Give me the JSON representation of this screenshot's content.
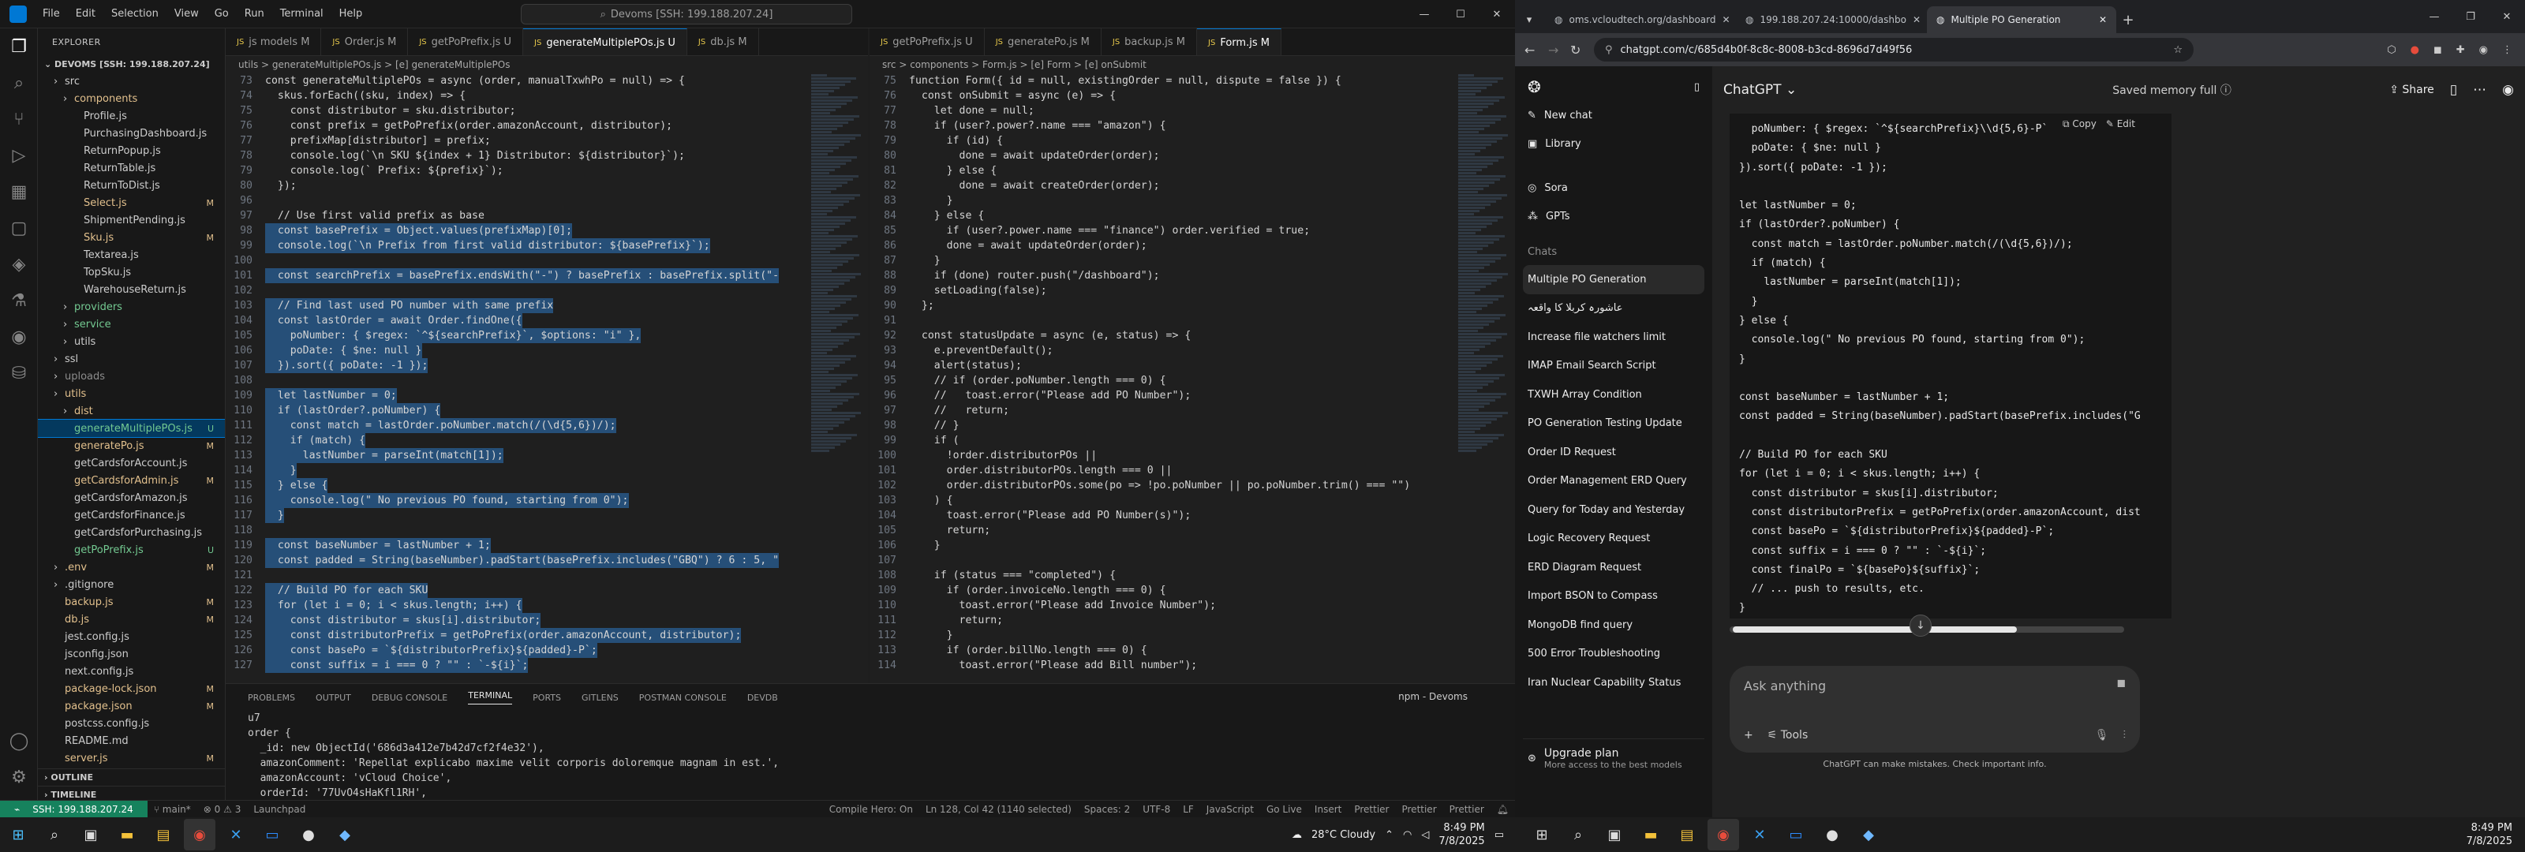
{
  "vscode": {
    "menu": [
      "File",
      "Edit",
      "Selection",
      "View",
      "Go",
      "Run",
      "Terminal",
      "Help"
    ],
    "command_center": "Devoms [SSH: 199.188.207.24]",
    "explorer_title": "EXPLORER",
    "workspace": "DEVOMS [SSH: 199.188.207.24]",
    "tree": [
      {
        "label": "src",
        "cls": "c-nor",
        "indent": 1
      },
      {
        "label": "components",
        "cls": "c-mod",
        "indent": 2
      },
      {
        "label": "Profile.js",
        "cls": "c-nor",
        "indent": 3
      },
      {
        "label": "PurchasingDashboard.js",
        "cls": "c-nor",
        "indent": 3
      },
      {
        "label": "ReturnPopup.js",
        "cls": "c-nor",
        "indent": 3
      },
      {
        "label": "ReturnTable.js",
        "cls": "c-nor",
        "indent": 3
      },
      {
        "label": "ReturnToDist.js",
        "cls": "c-nor",
        "indent": 3
      },
      {
        "label": "Select.js",
        "cls": "c-mod",
        "indent": 3,
        "badge": "M"
      },
      {
        "label": "ShipmentPending.js",
        "cls": "c-nor",
        "indent": 3
      },
      {
        "label": "Sku.js",
        "cls": "c-mod",
        "indent": 3,
        "badge": "M"
      },
      {
        "label": "Textarea.js",
        "cls": "c-nor",
        "indent": 3
      },
      {
        "label": "TopSku.js",
        "cls": "c-nor",
        "indent": 3
      },
      {
        "label": "WarehouseReturn.js",
        "cls": "c-nor",
        "indent": 3
      },
      {
        "label": "providers",
        "cls": "c-unt",
        "indent": 2
      },
      {
        "label": "service",
        "cls": "c-unt",
        "indent": 2
      },
      {
        "label": "utils",
        "cls": "c-nor",
        "indent": 2
      },
      {
        "label": "ssl",
        "cls": "c-nor",
        "indent": 1
      },
      {
        "label": "uploads",
        "cls": "c-dim",
        "indent": 1
      },
      {
        "label": "utils",
        "cls": "c-mod",
        "indent": 1
      },
      {
        "label": "dist",
        "cls": "c-mod",
        "indent": 2
      },
      {
        "label": "generateMultiplePOs.js",
        "cls": "c-unt",
        "indent": 2,
        "badge": "U",
        "sel": true
      },
      {
        "label": "generatePo.js",
        "cls": "c-mod",
        "indent": 2,
        "badge": "M"
      },
      {
        "label": "getCardsforAccount.js",
        "cls": "c-nor",
        "indent": 2
      },
      {
        "label": "getCardsforAdmin.js",
        "cls": "c-mod",
        "indent": 2,
        "badge": "M"
      },
      {
        "label": "getCardsforAmazon.js",
        "cls": "c-nor",
        "indent": 2
      },
      {
        "label": "getCardsforFinance.js",
        "cls": "c-nor",
        "indent": 2
      },
      {
        "label": "getCardsforPurchasing.js",
        "cls": "c-nor",
        "indent": 2
      },
      {
        "label": "getPoPrefix.js",
        "cls": "c-unt",
        "indent": 2,
        "badge": "U"
      },
      {
        "label": ".env",
        "cls": "c-mod",
        "indent": 1,
        "badge": "M"
      },
      {
        "label": ".gitignore",
        "cls": "c-nor",
        "indent": 1
      },
      {
        "label": "backup.js",
        "cls": "c-mod",
        "indent": 1,
        "badge": "M"
      },
      {
        "label": "db.js",
        "cls": "c-mod",
        "indent": 1,
        "badge": "M"
      },
      {
        "label": "jest.config.js",
        "cls": "c-nor",
        "indent": 1
      },
      {
        "label": "jsconfig.json",
        "cls": "c-nor",
        "indent": 1
      },
      {
        "label": "next.config.js",
        "cls": "c-nor",
        "indent": 1
      },
      {
        "label": "package-lock.json",
        "cls": "c-mod",
        "indent": 1,
        "badge": "M"
      },
      {
        "label": "package.json",
        "cls": "c-mod",
        "indent": 1,
        "badge": "M"
      },
      {
        "label": "postcss.config.js",
        "cls": "c-nor",
        "indent": 1
      },
      {
        "label": "README.md",
        "cls": "c-nor",
        "indent": 1
      },
      {
        "label": "server.js",
        "cls": "c-mod",
        "indent": 1,
        "badge": "M"
      }
    ],
    "outline_label": "OUTLINE",
    "timeline_label": "TIMELINE",
    "left_tabs": [
      {
        "label": "js models M"
      },
      {
        "label": "Order.js M"
      },
      {
        "label": "getPoPrefix.js U"
      },
      {
        "label": "generateMultiplePOs.js U",
        "active": true
      },
      {
        "label": "db.js M"
      }
    ],
    "right_tabs": [
      {
        "label": "getPoPrefix.js U"
      },
      {
        "label": "generatePo.js M"
      },
      {
        "label": "backup.js M"
      },
      {
        "label": "Form.js M",
        "active": true
      }
    ],
    "left_breadcrumb": "utils > generateMultiplePOs.js > [e] generateMultiplePOs",
    "right_breadcrumb": "src > components > Form.js > [e] Form > [e] onSubmit",
    "left_code": [
      {
        "n": "73",
        "t": "const generateMultiplePOs = async (order, manualTxwhPo = null) => {"
      },
      {
        "n": "74",
        "t": "  skus.forEach((sku, index) => {"
      },
      {
        "n": "",
        "t": "    const distributor = sku.distributor;"
      },
      {
        "n": "",
        "t": "    const prefix = getPoPrefix(order.amazonAccount, distributor);"
      },
      {
        "n": "",
        "t": "    prefixMap[distributor] = prefix;"
      },
      {
        "n": "",
        "t": "    console.log(`\\n SKU ${index + 1} Distributor: ${distributor}`);"
      },
      {
        "n": "",
        "t": "    console.log(` Prefix: ${prefix}`);"
      },
      {
        "n": "",
        "t": "  });"
      },
      {
        "n": "96",
        "t": ""
      },
      {
        "n": "97",
        "t": "  // Use first valid prefix as base"
      },
      {
        "n": "98",
        "t": "  const basePrefix = Object.values(prefixMap)[0];",
        "hl": true
      },
      {
        "n": "99",
        "t": "  console.log(`\\n Prefix from first valid distributor: ${basePrefix}`);",
        "hl": true
      },
      {
        "n": "100",
        "t": "",
        "hl": true
      },
      {
        "n": "101",
        "t": "  const searchPrefix = basePrefix.endsWith(\"-\") ? basePrefix : basePrefix.split(\"-",
        "hl": true
      },
      {
        "n": "102",
        "t": "",
        "hl": true
      },
      {
        "n": "103",
        "t": "  // Find last used PO number with same prefix",
        "hl": true
      },
      {
        "n": "104",
        "t": "  const lastOrder = await Order.findOne({",
        "hl": true
      },
      {
        "n": "105",
        "t": "    poNumber: { $regex: `^${searchPrefix}`, $options: \"i\" },",
        "hl": true
      },
      {
        "n": "106",
        "t": "    poDate: { $ne: null }",
        "hl": true
      },
      {
        "n": "107",
        "t": "  }).sort({ poDate: -1 });",
        "hl": true
      },
      {
        "n": "108",
        "t": "",
        "hl": true
      },
      {
        "n": "109",
        "t": "  let lastNumber = 0;",
        "hl": true
      },
      {
        "n": "110",
        "t": "  if (lastOrder?.poNumber) {",
        "hl": true
      },
      {
        "n": "111",
        "t": "    const match = lastOrder.poNumber.match(/(\\d{5,6})/);",
        "hl": true
      },
      {
        "n": "112",
        "t": "    if (match) {",
        "hl": true
      },
      {
        "n": "113",
        "t": "      lastNumber = parseInt(match[1]);",
        "hl": true
      },
      {
        "n": "114",
        "t": "    }",
        "hl": true
      },
      {
        "n": "115",
        "t": "  } else {",
        "hl": true
      },
      {
        "n": "116",
        "t": "    console.log(\" No previous PO found, starting from 0\");",
        "hl": true
      },
      {
        "n": "117",
        "t": "  }",
        "hl": true
      },
      {
        "n": "118",
        "t": "",
        "hl": true
      },
      {
        "n": "119",
        "t": "  const baseNumber = lastNumber + 1;",
        "hl": true
      },
      {
        "n": "120",
        "t": "  const padded = String(baseNumber).padStart(basePrefix.includes(\"GBQ\") ? 6 : 5, \"",
        "hl": true
      },
      {
        "n": "121",
        "t": "",
        "hl": true
      },
      {
        "n": "122",
        "t": "  // Build PO for each SKU",
        "hl": true
      },
      {
        "n": "123",
        "t": "  for (let i = 0; i < skus.length; i++) {",
        "hl": true
      },
      {
        "n": "124",
        "t": "    const distributor = skus[i].distributor;",
        "hl": true
      },
      {
        "n": "125",
        "t": "    const distributorPrefix = getPoPrefix(order.amazonAccount, distributor);",
        "hl": true
      },
      {
        "n": "126",
        "t": "    const basePo = `${distributorPrefix}${padded}-P`;",
        "hl": true
      },
      {
        "n": "127",
        "t": "    const suffix = i === 0 ? \"\" : `-${i}`;",
        "hl": true
      }
    ],
    "right_code": [
      {
        "n": "75",
        "t": "function Form({ id = null, existingOrder = null, dispute = false }) {"
      },
      {
        "n": "76",
        "t": "  const onSubmit = async (e) => {"
      },
      {
        "n": "",
        "t": "    let done = null;"
      },
      {
        "n": "",
        "t": "    if (user?.power?.name === \"amazon\") {"
      },
      {
        "n": "",
        "t": "      if (id) {"
      },
      {
        "n": "",
        "t": "        done = await updateOrder(order);"
      },
      {
        "n": "",
        "t": "      } else {"
      },
      {
        "n": "",
        "t": "        done = await createOrder(order);"
      },
      {
        "n": "",
        "t": "      }"
      },
      {
        "n": "",
        "t": "    } else {"
      },
      {
        "n": "",
        "t": "      if (user?.power.name === \"finance\") order.verified = true;"
      },
      {
        "n": "",
        "t": "      done = await updateOrder(order);"
      },
      {
        "n": "",
        "t": "    }"
      },
      {
        "n": "",
        "t": "    if (done) router.push(\"/dashboard\");"
      },
      {
        "n": "",
        "t": "    setLoading(false);"
      },
      {
        "n": "",
        "t": "  };"
      },
      {
        "n": "",
        "t": ""
      },
      {
        "n": "",
        "t": "  const statusUpdate = async (e, status) => {"
      },
      {
        "n": "",
        "t": "    e.preventDefault();"
      },
      {
        "n": "",
        "t": "    alert(status);"
      },
      {
        "n": "",
        "t": "    // if (order.poNumber.length === 0) {"
      },
      {
        "n": "",
        "t": "    //   toast.error(\"Please add PO Number\");"
      },
      {
        "n": "",
        "t": "    //   return;"
      },
      {
        "n": "",
        "t": "    // }"
      },
      {
        "n": "",
        "t": "    if ("
      },
      {
        "n": "",
        "t": "      !order.distributorPOs ||"
      },
      {
        "n": "",
        "t": "      order.distributorPOs.length === 0 ||"
      },
      {
        "n": "",
        "t": "      order.distributorPOs.some(po => !po.poNumber || po.poNumber.trim() === \"\")"
      },
      {
        "n": "",
        "t": "    ) {"
      },
      {
        "n": "",
        "t": "      toast.error(\"Please add PO Number(s)\");"
      },
      {
        "n": "",
        "t": "      return;"
      },
      {
        "n": "",
        "t": "    }"
      },
      {
        "n": "",
        "t": ""
      },
      {
        "n": "",
        "t": "    if (status === \"completed\") {"
      },
      {
        "n": "",
        "t": "      if (order.invoiceNo.length === 0) {"
      },
      {
        "n": "",
        "t": "        toast.error(\"Please add Invoice Number\");"
      },
      {
        "n": "",
        "t": "        return;"
      },
      {
        "n": "",
        "t": "      }"
      },
      {
        "n": "",
        "t": "      if (order.billNo.length === 0) {"
      },
      {
        "n": "",
        "t": "        toast.error(\"Please add Bill number\");"
      }
    ],
    "right_line_numbers": [
      "75",
      "76",
      "77",
      "78",
      "79",
      "80",
      "81",
      "82",
      "83",
      "84",
      "85",
      "86",
      "87",
      "88",
      "89",
      "90",
      "91",
      "92",
      "93",
      "94",
      "95",
      "96",
      "97",
      "98",
      "99",
      "100",
      "101",
      "102",
      "103",
      "104",
      "105",
      "106",
      "107",
      "108",
      "109",
      "110",
      "111",
      "112",
      "113",
      "114"
    ],
    "left_line_numbers": [
      "73",
      "74",
      "75",
      "76",
      "77",
      "78",
      "79",
      "80",
      "96",
      "97",
      "98",
      "99",
      "100",
      "101",
      "102",
      "103",
      "104",
      "105",
      "106",
      "107",
      "108",
      "109",
      "110",
      "111",
      "112",
      "113",
      "114",
      "115",
      "116",
      "117",
      "118",
      "119",
      "120",
      "121",
      "122",
      "123",
      "124",
      "125",
      "126",
      "127"
    ],
    "panel_tabs": [
      "PROBLEMS",
      "OUTPUT",
      "DEBUG CONSOLE",
      "TERMINAL",
      "PORTS",
      "GITLENS",
      "POSTMAN CONSOLE",
      "DEVDB"
    ],
    "terminal_label": "npm - Devoms",
    "terminal_lines": [
      "u7",
      "order {",
      "  _id: new ObjectId('686d3a412e7b42d7cf2f4e32'),",
      "  amazonComment: 'Repellat explicabo maxime velit corporis doloremque magnam in est.',",
      "  amazonAccount: 'vCloud Choice',",
      "  orderId: '77UvO4sHaKfl1RH',"
    ],
    "status": {
      "remote": "SSH: 199.188.207.24",
      "branch": "main*",
      "errors": "0",
      "warnings": "3",
      "launch": "Launchpad",
      "compile": "Compile Hero: On",
      "pos": "Ln 128, Col 42 (1140 selected)",
      "spaces": "Spaces: 2",
      "enc": "UTF-8",
      "eol": "LF",
      "lang": "JavaScript",
      "golive": "Go Live",
      "insert": "Insert",
      "prettier1": "Prettier",
      "prettier2": "Prettier",
      "prettier3": "Prettier"
    },
    "taskbar_weather": "28°C Cloudy",
    "clock_time": "8:49 PM",
    "clock_date": "7/8/2025"
  },
  "chrome": {
    "tabs": [
      {
        "label": "oms.vcloudtech.org/dashboard"
      },
      {
        "label": "199.188.207.24:10000/dashbo"
      },
      {
        "label": "Multiple PO Generation",
        "active": true
      }
    ],
    "url": "chatgpt.com/c/685d4b0f-8c8c-8008-b3cd-8696d7d49f56",
    "sidebar": {
      "new_chat": "New chat",
      "library": "Library",
      "sora": "Sora",
      "gpts": "GPTs",
      "chats_heading": "Chats",
      "chats": [
        "Multiple PO Generation",
        "عاشورہ کربلا کا واقعہ",
        "Increase file watchers limit",
        "IMAP Email Search Script",
        "TXWH Array Condition",
        "PO Generation Testing Update",
        "Order ID Request",
        "Order Management ERD Query",
        "Query for Today and Yesterday",
        "Logic Recovery Request",
        "ERD Diagram Request",
        "Import BSON to Compass",
        "MongoDB find query",
        "500 Error Troubleshooting",
        "Iran Nuclear Capability Status"
      ],
      "upgrade_title": "Upgrade plan",
      "upgrade_sub": "More access to the best models"
    },
    "main": {
      "model": "ChatGPT",
      "memory": "Saved memory full",
      "share": "Share",
      "copy": "Copy",
      "edit": "Edit",
      "code_lines": [
        "  poNumber: { $regex: `^${searchPrefix}\\\\d{5,6}-P`",
        "  poDate: { $ne: null }",
        "}).sort({ poDate: -1 });",
        "",
        "let lastNumber = 0;",
        "if (lastOrder?.poNumber) {",
        "  const match = lastOrder.poNumber.match(/(\\d{5,6})/);",
        "  if (match) {",
        "    lastNumber = parseInt(match[1]);",
        "  }",
        "} else {",
        "  console.log(\" No previous PO found, starting from 0\");",
        "}",
        "",
        "const baseNumber = lastNumber + 1;",
        "const padded = String(baseNumber).padStart(basePrefix.includes(\"G",
        "",
        "// Build PO for each SKU",
        "for (let i = 0; i < skus.length; i++) {",
        "  const distributor = skus[i].distributor;",
        "  const distributorPrefix = getPoPrefix(order.amazonAccount, dist",
        "  const basePo = `${distributorPrefix}${padded}-P`;",
        "  const suffix = i === 0 ? \"\" : `-${i}`;",
        "  const finalPo = `${basePo}${suffix}`;",
        "  // ... push to results, etc.",
        "}"
      ],
      "placeholder": "Ask anything",
      "tools": "Tools",
      "disclaimer": "ChatGPT can make mistakes. Check important info."
    }
  }
}
